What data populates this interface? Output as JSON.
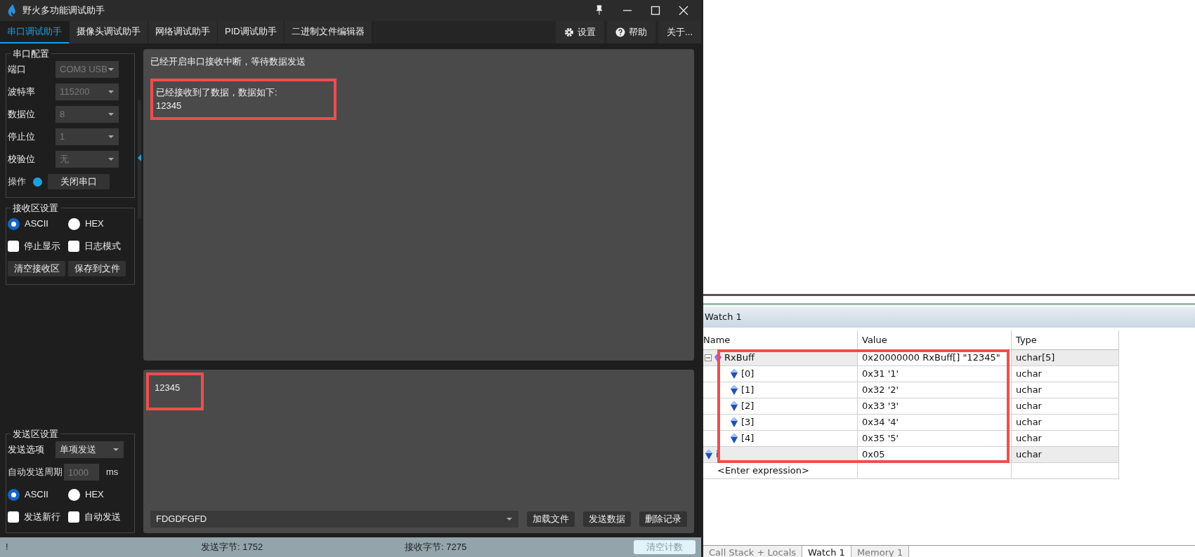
{
  "window": {
    "title": "野火多功能调试助手"
  },
  "tabs": [
    {
      "label": "串口调试助手",
      "selected": true
    },
    {
      "label": "摄像头调试助手",
      "selected": false
    },
    {
      "label": "网络调试助手",
      "selected": false
    },
    {
      "label": "PID调试助手",
      "selected": false
    },
    {
      "label": "二进制文件编辑器",
      "selected": false
    }
  ],
  "toolbar_buttons": [
    {
      "kind": "settings",
      "label": "设置"
    },
    {
      "kind": "help",
      "label": "帮助"
    },
    {
      "kind": "plain",
      "label": "关于..."
    }
  ],
  "serial_config": {
    "title": "串口配置",
    "fields": [
      {
        "label": "端口",
        "value": "COM3 USB",
        "disabled": true
      },
      {
        "label": "波特率",
        "value": "115200",
        "disabled": true
      },
      {
        "label": "数据位",
        "value": "8",
        "disabled": true
      },
      {
        "label": "停止位",
        "value": "1",
        "disabled": true
      },
      {
        "label": "校验位",
        "value": "无",
        "disabled": true
      }
    ],
    "operation": {
      "label": "操作",
      "connected": true,
      "button": "关闭串口"
    }
  },
  "receive_settings": {
    "title": "接收区设置",
    "format": [
      {
        "label": "ASCII",
        "selected": true
      },
      {
        "label": "HEX",
        "selected": false
      }
    ],
    "options": [
      {
        "label": "停止显示",
        "checked": false
      },
      {
        "label": "日志模式",
        "checked": false
      }
    ],
    "buttons": [
      "清空接收区",
      "保存到文件"
    ]
  },
  "send_settings": {
    "title": "发送区设置",
    "send_option": {
      "label": "发送选项",
      "value": "单项发送",
      "disabled": false
    },
    "auto_period": {
      "label": "自动发送周期",
      "value": "1000",
      "unit": "ms"
    },
    "format": [
      {
        "label": "ASCII",
        "selected": true
      },
      {
        "label": "HEX",
        "selected": false
      }
    ],
    "options": [
      {
        "label": "发送新行",
        "checked": false
      },
      {
        "label": "自动发送",
        "checked": false
      }
    ]
  },
  "receive_area": {
    "blocks": [
      {
        "lines": [
          "已经开启串口接收中断，等待数据发送"
        ],
        "highlighted": false
      },
      {
        "lines": [
          "已经接收到了数据，数据如下:",
          "12345"
        ],
        "highlighted": true
      }
    ]
  },
  "send_area": {
    "text": "12345",
    "highlighted": true,
    "history_value": "FDGDFGFD",
    "buttons": [
      "加载文件",
      "发送数据",
      "删除记录"
    ]
  },
  "status_bar": {
    "indicator": "!",
    "sent": "发送字节: 1752",
    "received": "接收字节: 7275",
    "clear_button": "清空计数"
  },
  "watch": {
    "title": "Watch 1",
    "columns": [
      "Name",
      "Value",
      "Type"
    ],
    "highlighted": true,
    "rows": [
      {
        "name": "RxBuff",
        "value": "0x20000000 RxBuff[] \"12345\"",
        "type": "uchar[5]",
        "expanded": true,
        "children": [
          {
            "name": "[0]",
            "value": "0x31 '1'",
            "type": "uchar"
          },
          {
            "name": "[1]",
            "value": "0x32 '2'",
            "type": "uchar"
          },
          {
            "name": "[2]",
            "value": "0x33 '3'",
            "type": "uchar"
          },
          {
            "name": "[3]",
            "value": "0x34 '4'",
            "type": "uchar"
          },
          {
            "name": "[4]",
            "value": "0x35 '5'",
            "type": "uchar"
          }
        ]
      },
      {
        "name": "i",
        "value": "0x05",
        "type": "uchar"
      }
    ],
    "placeholder": "<Enter expression>"
  },
  "bottom_tabs": [
    {
      "label": "Call Stack + Locals",
      "selected": false
    },
    {
      "label": "Watch 1",
      "selected": true
    },
    {
      "label": "Memory 1",
      "selected": false
    }
  ]
}
